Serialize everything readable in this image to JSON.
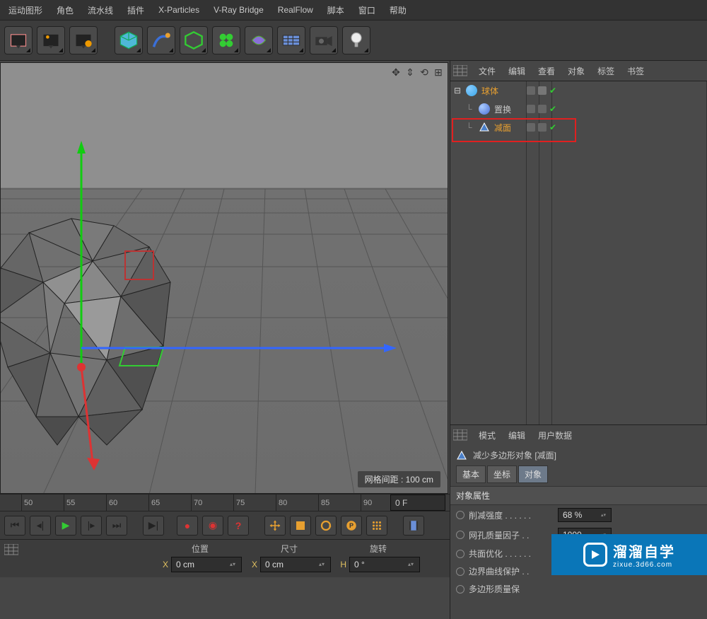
{
  "menu": [
    "运动图形",
    "角色",
    "流水线",
    "插件",
    "X-Particles",
    "V-Ray Bridge",
    "RealFlow",
    "脚本",
    "窗口",
    "帮助"
  ],
  "viewport": {
    "hud": "网格间距 : 100 cm"
  },
  "ruler": {
    "ticks": [
      "50",
      "55",
      "60",
      "65",
      "70",
      "75",
      "80",
      "85",
      "90"
    ],
    "current": "0 F"
  },
  "coordbar": {
    "groups": [
      {
        "head": "位置",
        "axis": "X",
        "val": "0 cm"
      },
      {
        "head": "尺寸",
        "axis": "X",
        "val": "0 cm"
      },
      {
        "head": "旋转",
        "axis": "H",
        "val": "0 °"
      }
    ],
    "gridhead": "位置"
  },
  "obj_panel": {
    "tabs": [
      "文件",
      "编辑",
      "查看",
      "对象",
      "标签",
      "书签"
    ],
    "items": [
      {
        "name": "球体",
        "indent": 0,
        "color": "#3aa6e8",
        "orange": true,
        "exp": "⊟"
      },
      {
        "name": "置换",
        "indent": 1,
        "color": "#4a6fd6",
        "orange": false,
        "exp": ""
      },
      {
        "name": "减面",
        "indent": 1,
        "color": "#3a6fa6",
        "orange": true,
        "exp": "",
        "tri": true
      }
    ]
  },
  "attr_panel": {
    "tabs": [
      "模式",
      "编辑",
      "用户数据"
    ],
    "title": "减少多边形对象 [减面]",
    "tabbtns": [
      "基本",
      "坐标",
      "对象"
    ],
    "section": "对象属性",
    "rows": [
      {
        "label": "削减强度 . . . . . .",
        "val": "68 %",
        "type": "num"
      },
      {
        "label": "网孔质量因子 . .",
        "val": "1000",
        "type": "num"
      },
      {
        "label": "共面优化 . . . . . .",
        "type": "check",
        "checked": true
      },
      {
        "label": "边界曲线保护 . .",
        "type": "check",
        "checked": true
      },
      {
        "label": "多边形质量保",
        "type": "check"
      }
    ]
  },
  "watermark": {
    "big": "溜溜自学",
    "sm": "zixue.3d66.com"
  }
}
